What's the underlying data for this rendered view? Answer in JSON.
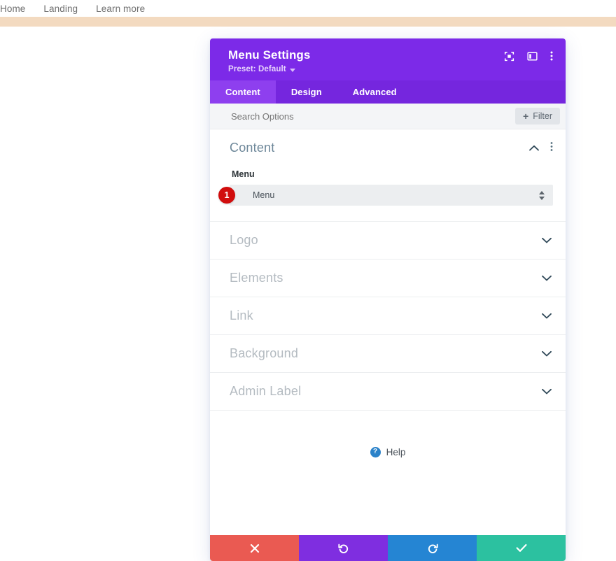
{
  "site_nav": {
    "items": [
      {
        "label": "Home"
      },
      {
        "label": "Landing"
      },
      {
        "label": "Learn more"
      }
    ]
  },
  "modal": {
    "title": "Menu Settings",
    "preset": "Preset: Default",
    "header_icons": [
      {
        "name": "focus-icon"
      },
      {
        "name": "panel-layout-icon"
      },
      {
        "name": "kebab-menu-icon"
      }
    ],
    "tabs": [
      {
        "label": "Content",
        "active": true
      },
      {
        "label": "Design",
        "active": false
      },
      {
        "label": "Advanced",
        "active": false
      }
    ],
    "search": {
      "placeholder": "Search Options"
    },
    "filter_button": {
      "label": "Filter",
      "plus": "+"
    },
    "content_section": {
      "title": "Content",
      "field_label": "Menu",
      "select_value": "Menu",
      "badge": "1"
    },
    "collapsed_sections": [
      {
        "label": "Logo"
      },
      {
        "label": "Elements"
      },
      {
        "label": "Link"
      },
      {
        "label": "Background"
      },
      {
        "label": "Admin Label"
      }
    ],
    "help": {
      "label": "Help",
      "icon_glyph": "?"
    },
    "footer_buttons": [
      {
        "name": "cancel-button",
        "icon": "close-icon"
      },
      {
        "name": "undo-button",
        "icon": "undo-icon"
      },
      {
        "name": "redo-button",
        "icon": "redo-icon"
      },
      {
        "name": "save-button",
        "icon": "check-icon"
      }
    ]
  },
  "colors": {
    "header_purple": "#7c2ae8",
    "tabbar_purple": "#7526de",
    "active_tab_purple": "#8e3fef",
    "beige_bar": "#f3dac0",
    "badge_red": "#d10d0d",
    "cancel_red": "#ea5a52",
    "undo_purple": "#7f2ee0",
    "redo_blue": "#2585d3",
    "save_green": "#2cc1a0",
    "help_blue": "#2b82c9",
    "section_title": "#6d8799",
    "collapsed_title": "#b4bbc1"
  }
}
